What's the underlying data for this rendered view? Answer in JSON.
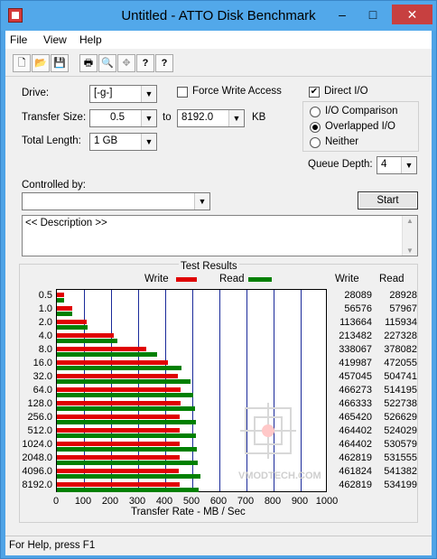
{
  "window": {
    "title": "Untitled - ATTO Disk Benchmark",
    "controls": {
      "minimize": "–",
      "maximize": "□",
      "close": "✕"
    }
  },
  "menu": [
    "File",
    "View",
    "Help"
  ],
  "toolbar": {
    "icons": [
      "new-icon",
      "open-icon",
      "save-icon",
      "print-icon",
      "print-preview-icon",
      "move-icon",
      "help-icon",
      "context-help-icon"
    ],
    "glyphs": [
      "🗋",
      "📂",
      "💾",
      "🖶",
      "🔍",
      "✥",
      "?",
      "?"
    ]
  },
  "form": {
    "drive_label": "Drive:",
    "drive_value": "[-g-]",
    "force_write_label": "Force Write Access",
    "force_write_checked": false,
    "direct_io_label": "Direct I/O",
    "direct_io_checked": true,
    "transfer_size_label": "Transfer Size:",
    "transfer_from": "0.5",
    "to_label": "to",
    "transfer_to": "8192.0",
    "kb_label": "KB",
    "total_length_label": "Total Length:",
    "total_length": "1 GB",
    "io_options": [
      {
        "label": "I/O Comparison",
        "selected": false
      },
      {
        "label": "Overlapped I/O",
        "selected": true
      },
      {
        "label": "Neither",
        "selected": false
      }
    ],
    "queue_depth_label": "Queue Depth:",
    "queue_depth": "4",
    "controlled_by_label": "Controlled by:",
    "controlled_by_value": "",
    "start_label": "Start",
    "description": "<< Description >>"
  },
  "results": {
    "title": "Test Results",
    "write_legend": "Write",
    "read_legend": "Read",
    "write_header": "Write",
    "read_header": "Read",
    "xlabel": "Transfer Rate - MB / Sec",
    "watermark": "VMODTECH.COM"
  },
  "chart_data": {
    "type": "bar",
    "orientation": "horizontal",
    "categories": [
      "0.5",
      "1.0",
      "2.0",
      "4.0",
      "8.0",
      "16.0",
      "32.0",
      "64.0",
      "128.0",
      "256.0",
      "512.0",
      "1024.0",
      "2048.0",
      "4096.0",
      "8192.0"
    ],
    "series": [
      {
        "name": "Write",
        "color": "#e00000",
        "values": [
          28089,
          56576,
          113664,
          213482,
          338067,
          419987,
          457045,
          466273,
          466333,
          465420,
          464402,
          464402,
          462819,
          461824,
          462819
        ]
      },
      {
        "name": "Read",
        "color": "#008000",
        "values": [
          28928,
          57967,
          115934,
          227328,
          378082,
          472055,
          504741,
          514195,
          522738,
          526629,
          524029,
          530579,
          531555,
          541382,
          534199
        ]
      }
    ],
    "xticks": [
      "0",
      "100",
      "200",
      "300",
      "400",
      "500",
      "600",
      "700",
      "800",
      "900",
      "1000"
    ],
    "xlim": [
      0,
      1000
    ],
    "xlabel": "Transfer Rate - MB / Sec",
    "grid": true,
    "legend": "top"
  },
  "status": "For Help, press F1"
}
